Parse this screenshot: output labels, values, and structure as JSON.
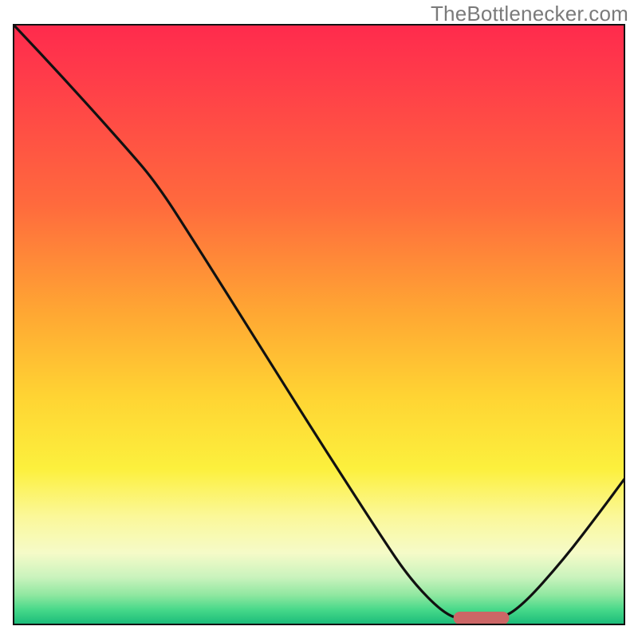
{
  "watermark": "TheBottlenecker.com",
  "chart_data": {
    "type": "line",
    "title": "",
    "xlabel": "",
    "ylabel": "",
    "x_range_normalized": [
      0,
      1
    ],
    "y_range_normalized": [
      0,
      1
    ],
    "description": "Bottleneck magnitude curve over a red→green vertical gradient. Curve value 1.0 = top (worst / red), 0.0 = bottom (best / green).",
    "series": [
      {
        "name": "bottleneck-curve",
        "note": "y is normalized height from bottom (0=bottom/green, 1=top/red).",
        "points": [
          {
            "x": 0.0,
            "y": 1.0
          },
          {
            "x": 0.09,
            "y": 0.902
          },
          {
            "x": 0.18,
            "y": 0.8
          },
          {
            "x": 0.235,
            "y": 0.735
          },
          {
            "x": 0.3,
            "y": 0.632
          },
          {
            "x": 0.4,
            "y": 0.47
          },
          {
            "x": 0.5,
            "y": 0.308
          },
          {
            "x": 0.6,
            "y": 0.15
          },
          {
            "x": 0.65,
            "y": 0.075
          },
          {
            "x": 0.705,
            "y": 0.018
          },
          {
            "x": 0.74,
            "y": 0.008
          },
          {
            "x": 0.79,
            "y": 0.008
          },
          {
            "x": 0.83,
            "y": 0.03
          },
          {
            "x": 0.9,
            "y": 0.11
          },
          {
            "x": 0.96,
            "y": 0.19
          },
          {
            "x": 1.0,
            "y": 0.245
          }
        ]
      }
    ],
    "marker": {
      "name": "optimal-zone",
      "note": "Rounded red-brown marker at bottom on the minimum of the curve.",
      "x_center": 0.765,
      "x_halfwidth": 0.035,
      "y": 0.012,
      "color": "#cc6666"
    },
    "gradient_stops": [
      {
        "pos": 0.0,
        "color": "#ff2a4d"
      },
      {
        "pos": 0.3,
        "color": "#ff6a3d"
      },
      {
        "pos": 0.62,
        "color": "#ffd433"
      },
      {
        "pos": 0.82,
        "color": "#fbf89a"
      },
      {
        "pos": 0.95,
        "color": "#8fe7a0"
      },
      {
        "pos": 1.0,
        "color": "#17b978"
      }
    ]
  }
}
